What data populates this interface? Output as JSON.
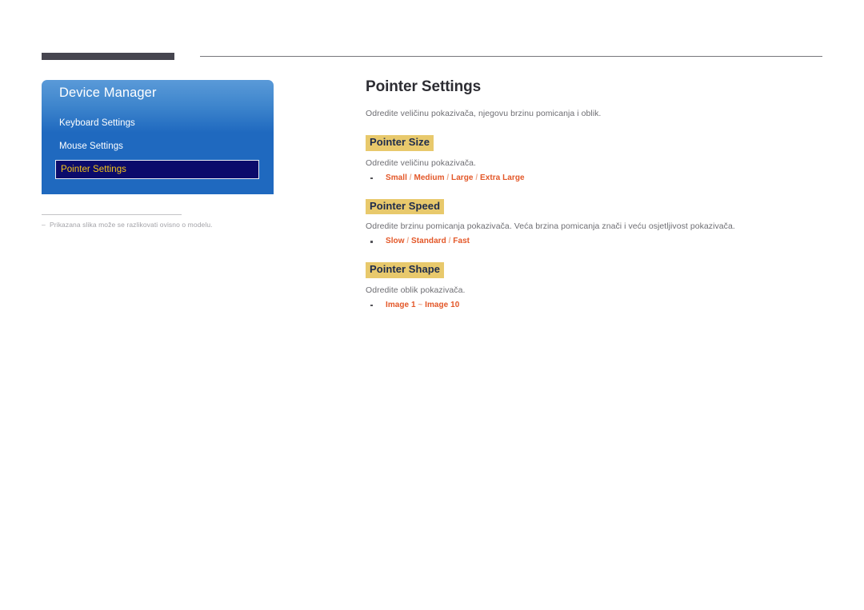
{
  "header": {
    "thick_bar": "",
    "thin_line": ""
  },
  "osd": {
    "title": "Device Manager",
    "items": [
      {
        "label": "Keyboard Settings",
        "selected": false
      },
      {
        "label": "Mouse Settings",
        "selected": false
      },
      {
        "label": "Pointer Settings",
        "selected": true
      }
    ],
    "selected_label": "Pointer Settings",
    "colors": {
      "panel_top": "#5a9ad8",
      "panel_bottom": "#1f69bf",
      "selected_bg": "#0b0b6b",
      "selected_text": "#f5c518",
      "item_text": "#ffffff"
    }
  },
  "footnote": {
    "dash": "–",
    "text": "Prikazana slika može se razlikovati ovisno o modelu."
  },
  "content": {
    "title": "Pointer Settings",
    "intro": "Odredite veličinu pokazivača, njegovu brzinu pomicanja i oblik.",
    "sections": [
      {
        "heading": "Pointer Size",
        "description": "Odredite veličinu pokazivača.",
        "options": [
          "Small",
          "Medium",
          "Large",
          "Extra Large"
        ],
        "separator": " / "
      },
      {
        "heading": "Pointer Speed",
        "description": "Odredite brzinu pomicanja pokazivača. Veća brzina pomicanja znači i veću osjetljivost pokazivača.",
        "options": [
          "Slow",
          "Standard",
          "Fast"
        ],
        "separator": " / "
      },
      {
        "heading": "Pointer Shape",
        "description": "Odredite oblik pokazivača.",
        "options": [
          "Image 1",
          "Image 10"
        ],
        "separator": " ~ "
      }
    ]
  },
  "colors": {
    "heading_highlight": "#e8c96c",
    "heading_text": "#1d2b4c",
    "option_text": "#e35728",
    "body_text": "#6e6e73",
    "title_text": "#2d2d33",
    "rule_dark": "#46454f",
    "rule_light": "#76767c"
  }
}
